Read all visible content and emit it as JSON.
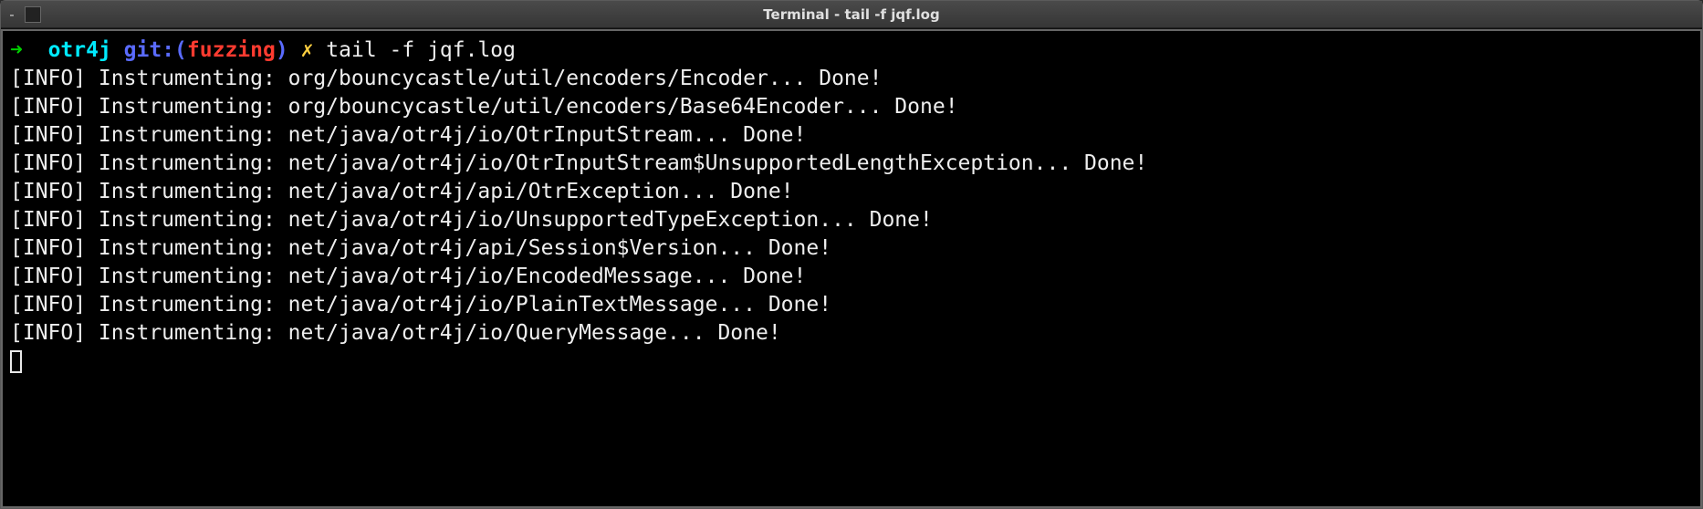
{
  "window": {
    "title": "Terminal - tail -f jqf.log",
    "minimize_glyph": "‐"
  },
  "prompt": {
    "arrow": "➜",
    "dir": "otr4j",
    "git_label": "git:(",
    "branch": "fuzzing",
    "git_close": ")",
    "dirty": "✗",
    "command": "tail -f jqf.log"
  },
  "log_lines": [
    "[INFO] Instrumenting: org/bouncycastle/util/encoders/Encoder... Done!",
    "[INFO] Instrumenting: org/bouncycastle/util/encoders/Base64Encoder... Done!",
    "[INFO] Instrumenting: net/java/otr4j/io/OtrInputStream... Done!",
    "[INFO] Instrumenting: net/java/otr4j/io/OtrInputStream$UnsupportedLengthException... Done!",
    "[INFO] Instrumenting: net/java/otr4j/api/OtrException... Done!",
    "[INFO] Instrumenting: net/java/otr4j/io/UnsupportedTypeException... Done!",
    "[INFO] Instrumenting: net/java/otr4j/api/Session$Version... Done!",
    "[INFO] Instrumenting: net/java/otr4j/io/EncodedMessage... Done!",
    "[INFO] Instrumenting: net/java/otr4j/io/PlainTextMessage... Done!",
    "[INFO] Instrumenting: net/java/otr4j/io/QueryMessage... Done!"
  ]
}
